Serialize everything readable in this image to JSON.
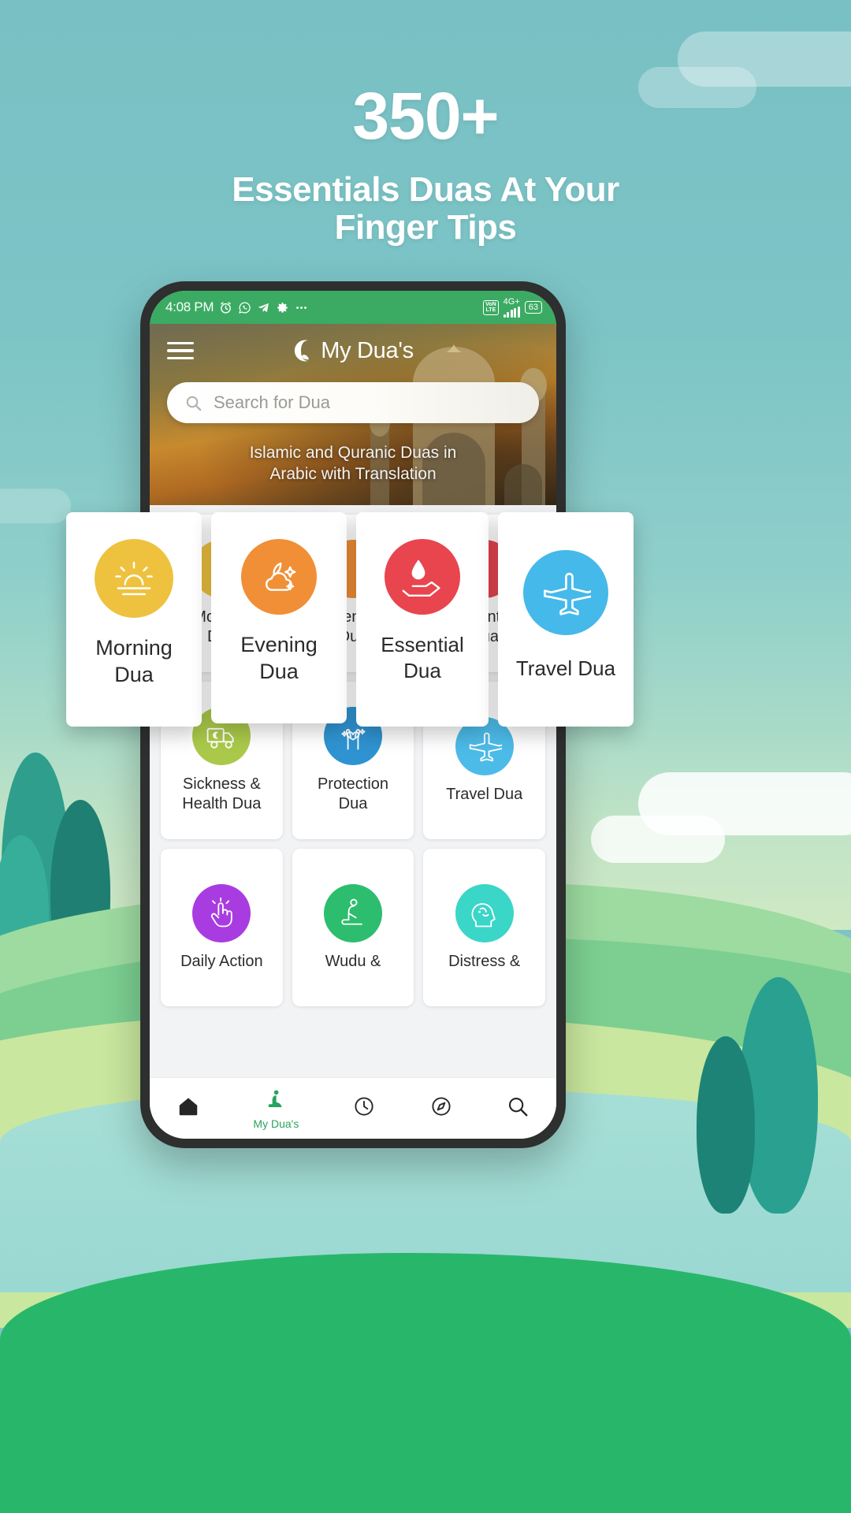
{
  "hero": {
    "headline": "350+",
    "subheadline_line1": "Essentials Duas At Your",
    "subheadline_line2": "Finger Tips"
  },
  "phone": {
    "status_bar": {
      "time": "4:08 PM",
      "left_icons": [
        "alarm-icon",
        "whatsapp-icon",
        "telegram-icon",
        "gear-icon",
        "more-icon"
      ],
      "volte_label_top": "VoN",
      "volte_label_bottom": "LTE",
      "network": "4G+",
      "battery_percent": "63"
    },
    "app_bar": {
      "menu_icon": "hamburger-icon",
      "logo_icon": "crescent-moon-icon",
      "title": "My Dua's",
      "subtitle_line1": "Islamic and Quranic Duas in",
      "subtitle_line2": "Arabic with Translation"
    },
    "search": {
      "icon": "search-icon",
      "placeholder": "Search for Dua",
      "value": ""
    },
    "grid": [
      {
        "label_line1": "Sickness &",
        "label_line2": "Health Dua",
        "icon": "ambulance-icon",
        "color": "#aac94a"
      },
      {
        "label_line1": "Protection",
        "label_line2": "Dua",
        "icon": "praying-hands-heart-icon",
        "color": "#2f93d1"
      },
      {
        "label_line1": "Travel Dua",
        "label_line2": "",
        "icon": "airplane-icon",
        "color": "#4cbbe8"
      },
      {
        "label_line1": "Daily Action",
        "label_line2": "",
        "icon": "hand-tap-icon",
        "color": "#a93ce0"
      },
      {
        "label_line1": "Wudu &",
        "label_line2": "",
        "icon": "praying-person-icon",
        "color": "#2dbd6e"
      },
      {
        "label_line1": "Distress &",
        "label_line2": "",
        "icon": "head-mind-icon",
        "color": "#3ad6c8"
      }
    ],
    "bottom_nav": [
      {
        "icon": "home-icon",
        "label": "",
        "active": false
      },
      {
        "icon": "praying-person-icon",
        "label": "My Dua's",
        "active": true
      },
      {
        "icon": "clock-icon",
        "label": "",
        "active": false
      },
      {
        "icon": "compass-icon",
        "label": "",
        "active": false
      },
      {
        "icon": "search-icon",
        "label": "",
        "active": false
      }
    ]
  },
  "floating_cards": [
    {
      "label_line1": "Morning",
      "label_line2": "Dua",
      "icon": "sunrise-icon",
      "color": "#eec23f"
    },
    {
      "label_line1": "Evening",
      "label_line2": "Dua",
      "icon": "moon-cloud-icon",
      "color": "#f08f36"
    },
    {
      "label_line1": "Essential",
      "label_line2": "Dua",
      "icon": "water-hand-icon",
      "color": "#e8454f"
    },
    {
      "label_line1": "Travel Dua",
      "label_line2": "",
      "icon": "airplane-icon",
      "color": "#45b9e9"
    }
  ],
  "colors": {
    "background_sky": "#7cc4c6",
    "ground_green": "#28b76a",
    "status_bar_green": "#3bab63",
    "accent_green": "#27a35c"
  }
}
